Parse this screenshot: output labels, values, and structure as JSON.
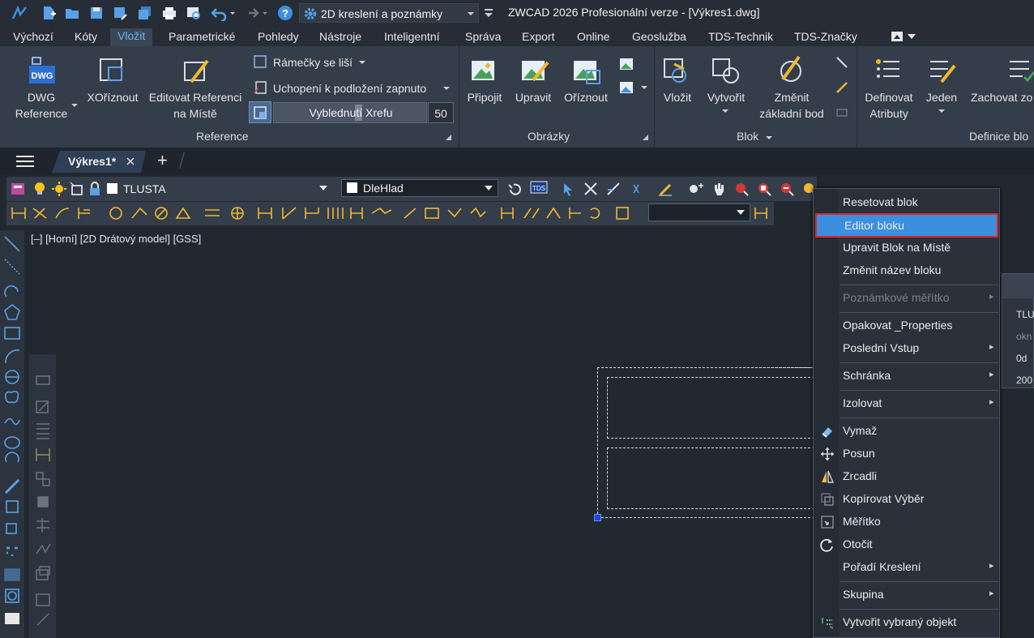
{
  "title_bar": {
    "workspace_label": "2D kreslení a poznámky",
    "app_title": "ZWCAD 2026 Profesionální verze - [Výkres1.dwg]"
  },
  "menu": {
    "items": [
      "Výchozí",
      "Kóty",
      "Vložit",
      "Parametrické",
      "Pohledy",
      "Nástroje",
      "Inteligentní",
      "Správa",
      "Export",
      "Online",
      "Geoslužba",
      "TDS-Technik",
      "TDS-Značky"
    ],
    "active": "Vložit"
  },
  "ribbon": {
    "reference": {
      "title": "Reference",
      "dwg_ref_line1": "DWG",
      "dwg_ref_line2": "Reference",
      "dwg_icon_text": "DWG",
      "xclip": "XOříznout",
      "edit_ref_line1": "Editovat Referenci",
      "edit_ref_line2": "na Místě",
      "frames": "Rámečky se liší",
      "snap": "Uchopení k podložení zapnuto",
      "fade_label": "Vyblednutí Xrefu",
      "fade_value": "50"
    },
    "images": {
      "title": "Obrázky",
      "attach": "Připojit",
      "adjust": "Upravit",
      "clip": "Oříznout"
    },
    "block": {
      "title": "Blok",
      "insert": "Vložit",
      "create": "Vytvořit",
      "base_line1": "Změnit",
      "base_line2": "základní bod"
    },
    "block_def": {
      "title": "Definice blo",
      "define_attr_line1": "Definovat",
      "define_attr_line2": "Atributy",
      "single": "Jeden",
      "retain": "Zachovat zo"
    }
  },
  "tabs": {
    "file_tab": "Výkres1*",
    "add_symbol": "+"
  },
  "layer_toolbar": {
    "layer_name": "TLUSTA",
    "style_name": "DleHlad"
  },
  "viewport_label": "[–] [Horní] [2D Drátový model] [GSS]",
  "properties_peek": [
    "TLU",
    "okn",
    "0d",
    "200"
  ],
  "context_menu": [
    {
      "label": "Resetovat blok",
      "icon": "",
      "submenu": false,
      "disabled": false,
      "highlighted": false
    },
    {
      "label": "Editor bloku",
      "icon": "",
      "submenu": false,
      "disabled": false,
      "highlighted": true
    },
    {
      "label": "Upravit Blok na Místě",
      "icon": "",
      "submenu": false,
      "disabled": false,
      "highlighted": false
    },
    {
      "label": "Změnit název bloku",
      "icon": "",
      "submenu": false,
      "disabled": false,
      "highlighted": false
    },
    {
      "label": "Poznámkové měřítko",
      "icon": "",
      "submenu": true,
      "disabled": true,
      "highlighted": false
    },
    {
      "label": "Opakovat _Properties",
      "icon": "",
      "submenu": false,
      "disabled": false,
      "highlighted": false
    },
    {
      "label": "Poslední Vstup",
      "icon": "",
      "submenu": true,
      "disabled": false,
      "highlighted": false
    },
    {
      "label": "Schránka",
      "icon": "",
      "submenu": true,
      "disabled": false,
      "highlighted": false
    },
    {
      "label": "Izolovat",
      "icon": "",
      "submenu": true,
      "disabled": false,
      "highlighted": false
    },
    {
      "label": "Vymaž",
      "icon": "eraser-icon",
      "submenu": false,
      "disabled": false,
      "highlighted": false
    },
    {
      "label": "Posun",
      "icon": "move-icon",
      "submenu": false,
      "disabled": false,
      "highlighted": false
    },
    {
      "label": "Zrcadli",
      "icon": "mirror-icon",
      "submenu": false,
      "disabled": false,
      "highlighted": false
    },
    {
      "label": "Kopírovat Výběr",
      "icon": "copy-icon",
      "submenu": false,
      "disabled": false,
      "highlighted": false
    },
    {
      "label": "Měřítko",
      "icon": "scale-icon",
      "submenu": false,
      "disabled": false,
      "highlighted": false
    },
    {
      "label": "Otočit",
      "icon": "rotate-icon",
      "submenu": false,
      "disabled": false,
      "highlighted": false
    },
    {
      "label": "Pořadí Kreslení",
      "icon": "",
      "submenu": true,
      "disabled": false,
      "highlighted": false
    },
    {
      "label": "Skupina",
      "icon": "",
      "submenu": true,
      "disabled": false,
      "highlighted": false
    },
    {
      "label": "Vytvořit vybraný objekt",
      "icon": "create-selected-icon",
      "submenu": false,
      "disabled": false,
      "highlighted": false
    }
  ],
  "colors": {
    "highlight": "#3c8fde",
    "highlight_border": "#e0262b",
    "accent": "#6fb6f0",
    "grip": "#1747e6"
  }
}
